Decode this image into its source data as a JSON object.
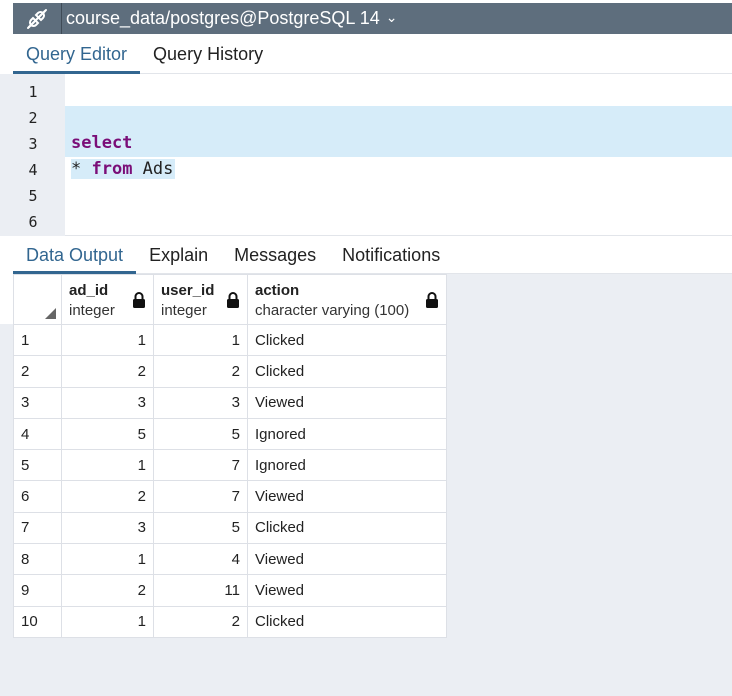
{
  "titlebar": {
    "connection_icon": "connection-plug-icon",
    "title": "course_data/postgres@PostgreSQL 14",
    "chevron": "⌄"
  },
  "top_tabs": [
    {
      "label": "Query Editor",
      "active": true
    },
    {
      "label": "Query History",
      "active": false
    }
  ],
  "editor": {
    "line_numbers": [
      "1",
      "2",
      "3",
      "4",
      "5",
      "6"
    ],
    "line3_keyword": "select",
    "line4_star": "* ",
    "line4_keyword": "from",
    "line4_table": " Ads"
  },
  "result_tabs": [
    {
      "label": "Data Output",
      "active": true
    },
    {
      "label": "Explain",
      "active": false
    },
    {
      "label": "Messages",
      "active": false
    },
    {
      "label": "Notifications",
      "active": false
    }
  ],
  "grid": {
    "columns": [
      {
        "name": "ad_id",
        "type": "integer",
        "icon": "lock-icon"
      },
      {
        "name": "user_id",
        "type": "integer",
        "icon": "lock-icon"
      },
      {
        "name": "action",
        "type": "character varying (100)",
        "icon": "lock-icon"
      }
    ],
    "rows": [
      {
        "n": "1",
        "ad_id": "1",
        "user_id": "1",
        "action": "Clicked"
      },
      {
        "n": "2",
        "ad_id": "2",
        "user_id": "2",
        "action": "Clicked"
      },
      {
        "n": "3",
        "ad_id": "3",
        "user_id": "3",
        "action": "Viewed"
      },
      {
        "n": "4",
        "ad_id": "5",
        "user_id": "5",
        "action": "Ignored"
      },
      {
        "n": "5",
        "ad_id": "1",
        "user_id": "7",
        "action": "Ignored"
      },
      {
        "n": "6",
        "ad_id": "2",
        "user_id": "7",
        "action": "Viewed"
      },
      {
        "n": "7",
        "ad_id": "3",
        "user_id": "5",
        "action": "Clicked"
      },
      {
        "n": "8",
        "ad_id": "1",
        "user_id": "4",
        "action": "Viewed"
      },
      {
        "n": "9",
        "ad_id": "2",
        "user_id": "11",
        "action": "Viewed"
      },
      {
        "n": "10",
        "ad_id": "1",
        "user_id": "2",
        "action": "Clicked"
      }
    ]
  },
  "colors": {
    "titlebar_bg": "#5e6e7d",
    "accent": "#326690",
    "keyword": "#7a0e78",
    "selection": "#d6ecf9",
    "panel_bg": "#ebeef3"
  }
}
